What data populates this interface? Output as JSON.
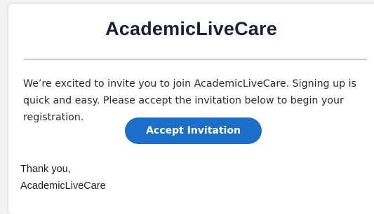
{
  "email": {
    "brand_name": "AcademicLiveCare",
    "message": "We’re excited to invite you to join AcademicLiveCare. Signing up is quick and easy. Please accept the invitation below to begin your registration.",
    "cta_label": "Accept Invitation",
    "closing": "Thank you,",
    "signature": "AcademicLiveCare"
  },
  "colors": {
    "brand_text": "#1a1f3d",
    "button_bg": "#1b6fc8",
    "button_text": "#ffffff",
    "body_text": "#2b2b2b",
    "divider": "#8a8a8a"
  }
}
